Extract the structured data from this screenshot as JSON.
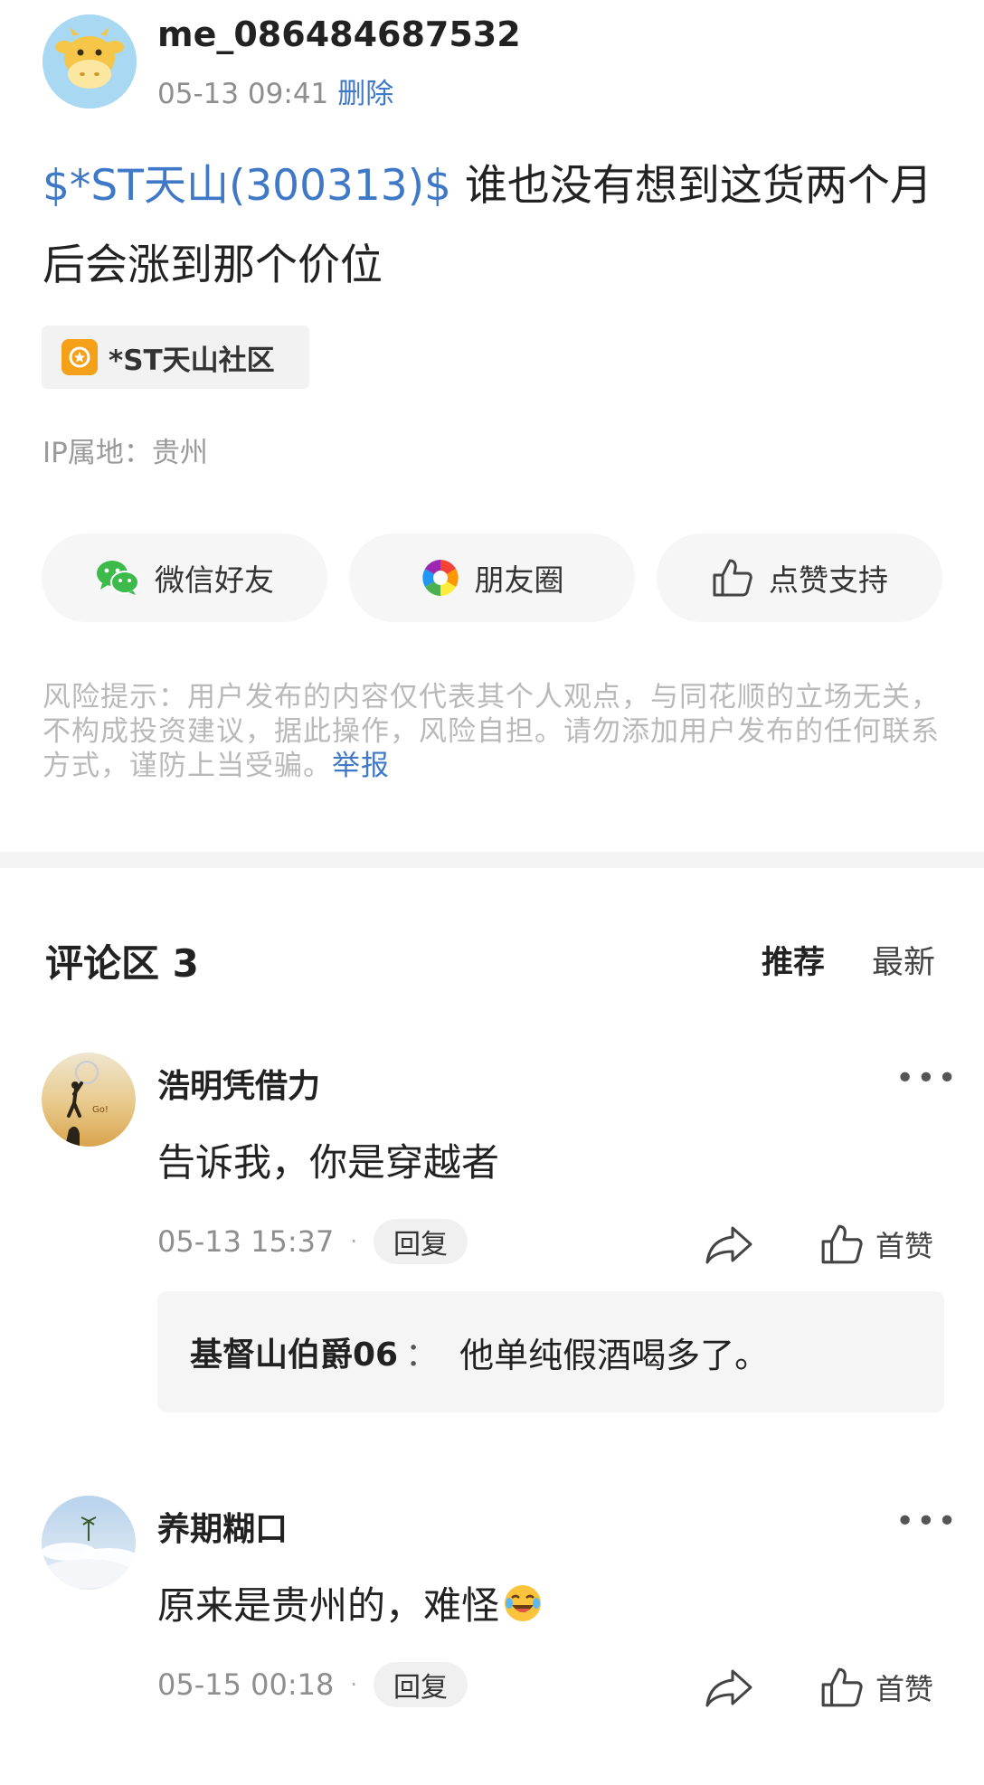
{
  "post": {
    "username": "me_086484687532",
    "time": "05-13 09:41",
    "delete_label": "删除",
    "stock_tag": "$*ST天山(300313)$",
    "text": " 谁也没有想到这货两个月后会涨到那个价位",
    "community_label": "*ST天山社区",
    "ip_location": "IP属地：贵州"
  },
  "share": {
    "wechat_label": "微信好友",
    "moments_label": "朋友圈",
    "like_label": "点赞支持"
  },
  "risk": {
    "text": "风险提示：用户发布的内容仅代表其个人观点，与同花顺的立场无关，不构成投资建议，据此操作，风险自担。请勿添加用户发布的任何联系方式，谨防上当受骗。",
    "report_label": "举报"
  },
  "comments_header": {
    "title": "评论区 3",
    "sort_recommended": "推荐",
    "sort_latest": "最新"
  },
  "comments": [
    {
      "name": "浩明凭借力",
      "text": "告诉我，你是穿越者",
      "time": "05-13 15:37",
      "dot": "·",
      "reply_label": "回复",
      "like_label": "首赞",
      "more": "•••",
      "sub_reply": {
        "user": "基督山伯爵06",
        "colon": "：",
        "text": "他单纯假酒喝多了。"
      }
    },
    {
      "name": "养期糊口",
      "text": "原来是贵州的，难怪",
      "time": "05-15 00:18",
      "dot": "·",
      "reply_label": "回复",
      "like_label": "首赞",
      "more": "•••"
    }
  ],
  "colors": {
    "link": "#3f78c6",
    "community_icon": "#f4a018"
  },
  "icons": [
    "cow-avatar-icon",
    "community-icon",
    "wechat-icon",
    "moments-icon",
    "thumbs-up-icon",
    "share-arrow-icon",
    "more-icon",
    "laughing-emoji-icon"
  ]
}
